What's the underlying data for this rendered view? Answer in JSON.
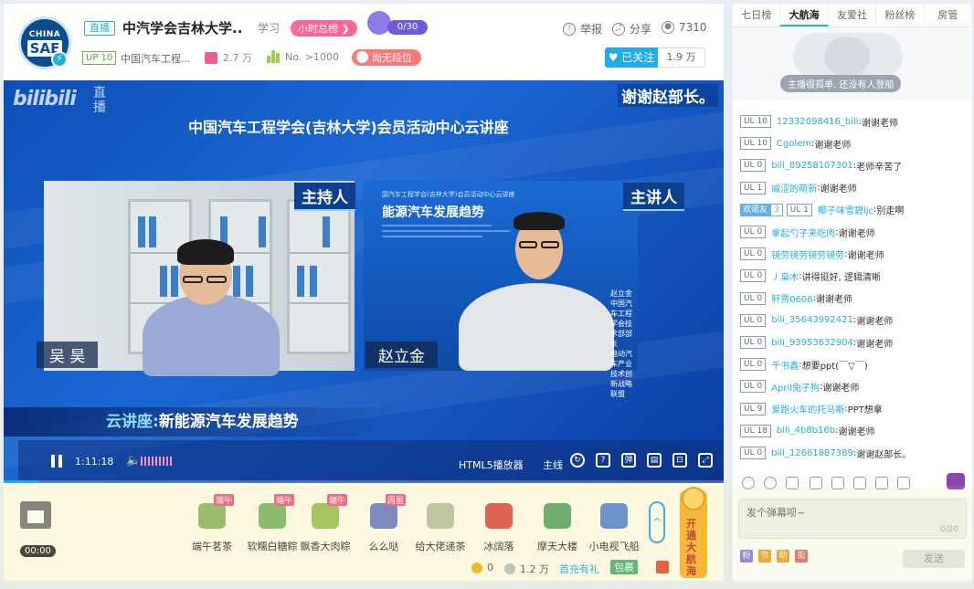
{
  "header": {
    "avatar_line1": "CHINA",
    "avatar_line2": "SAE",
    "live_tag": "直播",
    "room_title": "中汽学会吉林大学..",
    "title_extra": "学习",
    "hourly_rank": "小时总榜 ❯",
    "guard_progress": "0/30",
    "report_label": "举报",
    "share_label": "分享",
    "viewer_count": "7310",
    "up_level": "UP 10",
    "anchor_name": "中国汽车工程...",
    "gift_count": "2.7 万",
    "rank_no": "No. >1000",
    "no_rank_label": "尚无段位",
    "follow_label": "♥ 已关注",
    "follower_count": "1.9 万"
  },
  "player": {
    "bili_logo": "bilibili",
    "bili_live": "直播",
    "thanks_text": "谢谢赵部长。",
    "lecture_title": "中国汽车工程学会(吉林大学)会员活动中心云讲座",
    "host_role": "主持人",
    "speaker_role": "主讲人",
    "host_name": "吴 昊",
    "speaker_name": "赵立金",
    "slide_small": "国汽车工程学会(吉林大学)会员活动中心云讲座",
    "slide_title": "能源汽车发展趋势",
    "speaker_sig_1": "赵立金",
    "speaker_sig_2": "中国汽车工程学会技术部部长",
    "speaker_sig_3": "电动汽车产业技术创新战略联盟",
    "banner_prefix": "云讲座:",
    "banner_text": "新能源汽车发展趋势",
    "time": "1:11:18",
    "player_name": "HTML5播放器",
    "line_label": "主线",
    "progress_value": 0.05
  },
  "gift_bar": {
    "timer": "00:00",
    "gifts": [
      {
        "label": "端午茗茶",
        "tag": "端午",
        "color": "#8fb86b"
      },
      {
        "label": "软糯白糖粽",
        "tag": "端午",
        "color": "#7db86a"
      },
      {
        "label": "飘香大肉粽",
        "tag": "端午",
        "color": "#9bc35d"
      },
      {
        "label": "么么哒",
        "tag": "周星",
        "color": "#6f7fc9"
      },
      {
        "label": "给大佬递茶",
        "tag": "",
        "color": "#b9c3a0"
      },
      {
        "label": "冰阔落",
        "tag": "",
        "color": "#e0544d"
      },
      {
        "label": "摩天大楼",
        "tag": "",
        "color": "#5aa86b"
      },
      {
        "label": "小电视飞船",
        "tag": "",
        "color": "#5a8ad8"
      }
    ],
    "fleet_label": "开通大航海",
    "gold_balance": "0",
    "silver_balance": "1.2 万",
    "first_charge": "首充有礼",
    "redpack": "包裹"
  },
  "right_panel": {
    "tabs": [
      "七日榜",
      "大航海",
      "友爱社",
      "粉丝榜",
      "房管"
    ],
    "active_tab": "大航海",
    "fleet_note": "主播很孤单, 还没有人登船",
    "danmaku": [
      {
        "level": "UL 10",
        "user": "12332098416_bili",
        "text": "谢谢老师"
      },
      {
        "level": "UL 10",
        "user": "Cgolem",
        "text": "谢谢老师"
      },
      {
        "level": "UL 0",
        "user": "bili_89258107301",
        "text": "老师辛苦了"
      },
      {
        "level": "UL 1",
        "user": "威涩的萌新",
        "text": "谢谢老师"
      },
      {
        "level": "UL 1",
        "user": "椰子味雪碧ljc",
        "text": "别走啊",
        "medal": "欢诺友",
        "medal_lv": "3"
      },
      {
        "level": "UL 0",
        "user": "拿起勺子来吃肉",
        "text": "谢谢老师"
      },
      {
        "level": "UL 0",
        "user": "镜劳镜劳镜劳镜劳",
        "text": "谢谢老师"
      },
      {
        "level": "UL 0",
        "user": "丿枭木",
        "text": "讲得挺好, 逻辑清晰"
      },
      {
        "level": "UL 0",
        "user": "轩贾0608",
        "text": "谢谢老师"
      },
      {
        "level": "UL 0",
        "user": "bili_35643992421",
        "text": "谢谢老师"
      },
      {
        "level": "UL 0",
        "user": "bili_93953632904",
        "text": "谢谢老师"
      },
      {
        "level": "UL 0",
        "user": "千书鑫",
        "text": "想要ppt(￣▽￣)"
      },
      {
        "level": "UL 0",
        "user": "April兔子狗",
        "text": "谢谢老师"
      },
      {
        "level": "UL 9",
        "user": "爱跑火车的托马斯",
        "text": "PPT想拿"
      },
      {
        "level": "UL 18",
        "user": "bili_4b8b16b",
        "text": "谢谢老师"
      },
      {
        "level": "UL 0",
        "user": "bili_12661887389",
        "text": "谢谢赵部长。"
      }
    ],
    "input_placeholder": "发个弹幕呗~",
    "char_count": "0/20",
    "quick_tags": [
      "粉",
      "节",
      "助",
      "街"
    ],
    "send_label": "发送"
  }
}
